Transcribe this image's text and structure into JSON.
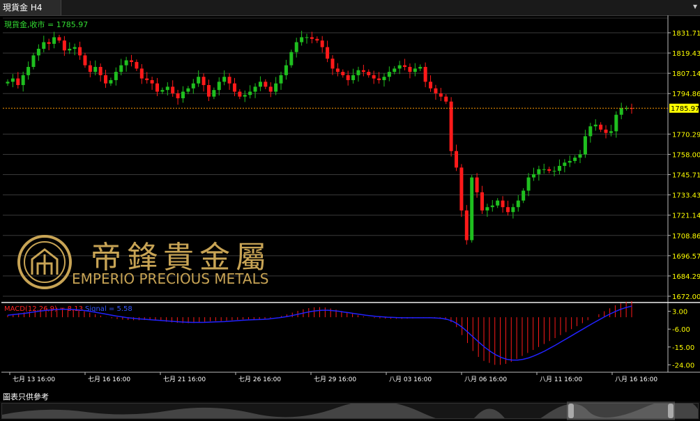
{
  "window": {
    "tab_title": "現貨金 H4",
    "menu_glyph": "▾"
  },
  "price_panel": {
    "header_label": "現貨金,收市 = 1785.97",
    "current_price": "1785.97",
    "y_ticks": [
      "1831.71",
      "1819.43",
      "1807.14",
      "1794.86",
      "1770.29",
      "1758.00",
      "1745.71",
      "1733.43",
      "1721.14",
      "1708.86",
      "1696.57",
      "1684.29",
      "1672.00"
    ]
  },
  "macd_panel": {
    "label_name": "MACD(12,26,9) = 8.13",
    "label_signal": "Signal = 5.58",
    "y_ticks": [
      "3.00",
      "-6.00",
      "-15.00",
      "-24.00"
    ]
  },
  "x_axis": {
    "labels": [
      "七月 13 16:00",
      "七月 16 16:00",
      "七月 21 16:00",
      "七月 26 16:00",
      "七月 29 16:00",
      "八月 03 16:00",
      "八月 06 16:00",
      "八月 11 16:00",
      "八月 16 16:00"
    ]
  },
  "watermark": {
    "chinese": "帝鋒貴金屬",
    "english": "EMPERIO PRECIOUS METALS"
  },
  "footer": {
    "disclaimer": "圖表只供參考"
  },
  "colors": {
    "up": "#1fbf1f",
    "down": "#ff1a1a",
    "axis_text": "#ffff00",
    "signal": "#2222ff",
    "gold": "#c8a455"
  },
  "chart_data": {
    "type": "candlestick",
    "symbol": "現貨金",
    "timeframe": "H4",
    "ylim": [
      1672.0,
      1831.71
    ],
    "closes": [
      1802,
      1804,
      1800,
      1806,
      1811,
      1818,
      1822,
      1826,
      1825,
      1829,
      1827,
      1821,
      1822,
      1823,
      1818,
      1812,
      1808,
      1811,
      1806,
      1801,
      1803,
      1808,
      1812,
      1815,
      1814,
      1810,
      1804,
      1803,
      1801,
      1796,
      1797,
      1799,
      1795,
      1792,
      1796,
      1798,
      1801,
      1805,
      1800,
      1793,
      1797,
      1802,
      1805,
      1801,
      1796,
      1793,
      1794,
      1796,
      1799,
      1802,
      1799,
      1796,
      1801,
      1806,
      1812,
      1820,
      1826,
      1829,
      1829,
      1828,
      1827,
      1823,
      1816,
      1810,
      1808,
      1806,
      1803,
      1806,
      1809,
      1808,
      1806,
      1804,
      1803,
      1805,
      1808,
      1810,
      1812,
      1811,
      1808,
      1810,
      1811,
      1802,
      1798,
      1795,
      1793,
      1790,
      1760,
      1750,
      1724,
      1706,
      1744,
      1735,
      1724,
      1726,
      1727,
      1730,
      1726,
      1723,
      1726,
      1730,
      1736,
      1744,
      1746,
      1749,
      1749,
      1748,
      1748,
      1751,
      1753,
      1754,
      1756,
      1758,
      1769,
      1775,
      1776,
      1773,
      1771,
      1772,
      1782,
      1786,
      1786,
      1785.97
    ],
    "macd_histogram": [
      1,
      1.5,
      2,
      2.5,
      3,
      3.6,
      4,
      4.3,
      4.5,
      4.6,
      4.6,
      4.4,
      4.1,
      3.6,
      3,
      2.3,
      1.5,
      0.8,
      0.1,
      -0.5,
      -0.9,
      -1.2,
      -1.4,
      -1.5,
      -1.5,
      -1.4,
      -1.4,
      -1.6,
      -1.9,
      -2.3,
      -2.6,
      -2.8,
      -3,
      -3,
      -2.9,
      -2.6,
      -2.3,
      -2,
      -1.9,
      -1.9,
      -1.7,
      -1.5,
      -1.3,
      -1.1,
      -1,
      -1,
      -0.9,
      -0.7,
      -0.4,
      0,
      0.6,
      1.4,
      2.3,
      3.2,
      4,
      4.6,
      5,
      5.1,
      4.9,
      4.4,
      3.8,
      3.1,
      2.4,
      1.7,
      1,
      0.4,
      -0.1,
      -0.4,
      -0.6,
      -0.7,
      -0.8,
      -0.8,
      -0.8,
      -0.7,
      -0.6,
      -0.5,
      -0.4,
      -0.3,
      -0.3,
      -0.5,
      -1,
      -2.5,
      -5,
      -9,
      -13,
      -17,
      -20,
      -22,
      -23,
      -24,
      -24,
      -23.5,
      -22.5,
      -21,
      -19.5,
      -18,
      -16.5,
      -15,
      -13.5,
      -12,
      -10.5,
      -9,
      -7.5,
      -6,
      -4.5,
      -3,
      -1.5,
      0,
      1.5,
      3,
      4.5,
      6,
      7,
      7.8,
      8.13
    ],
    "signal_line": [
      1,
      1.3,
      1.6,
      1.9,
      2.3,
      2.7,
      3.1,
      3.4,
      3.7,
      3.9,
      4,
      4,
      3.9,
      3.7,
      3.4,
      3,
      2.6,
      2.1,
      1.6,
      1.1,
      0.6,
      0.2,
      -0.2,
      -0.5,
      -0.8,
      -1,
      -1.2,
      -1.4,
      -1.6,
      -1.8,
      -2,
      -2.2,
      -2.4,
      -2.5,
      -2.6,
      -2.6,
      -2.6,
      -2.5,
      -2.4,
      -2.3,
      -2.2,
      -2,
      -1.8,
      -1.6,
      -1.4,
      -1.3,
      -1.2,
      -1.1,
      -0.9,
      -0.6,
      -0.3,
      0.1,
      0.6,
      1.2,
      1.8,
      2.4,
      2.9,
      3.3,
      3.5,
      3.5,
      3.3,
      3,
      2.6,
      2.2,
      1.8,
      1.4,
      1,
      0.7,
      0.4,
      0.2,
      0,
      -0.1,
      -0.2,
      -0.3,
      -0.3,
      -0.3,
      -0.3,
      -0.3,
      -0.3,
      -0.4,
      -0.6,
      -1.1,
      -2,
      -3.6,
      -5.6,
      -8,
      -10.5,
      -13,
      -15.3,
      -17.3,
      -19,
      -20.3,
      -21.2,
      -21.6,
      -21.6,
      -21.2,
      -20.5,
      -19.5,
      -18.3,
      -17,
      -15.5,
      -14,
      -12.4,
      -10.8,
      -9.2,
      -7.6,
      -6,
      -4.4,
      -2.8,
      -1.3,
      0.2,
      1.6,
      2.9,
      4,
      4.9,
      5.58
    ],
    "macd_ylim": [
      -27,
      6
    ]
  }
}
